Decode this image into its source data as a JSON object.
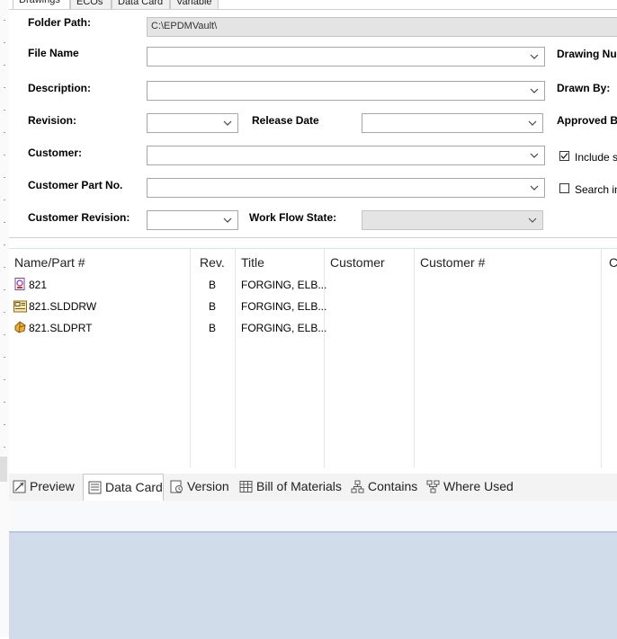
{
  "top_tabs": [
    "Drawings",
    "ECOs",
    "Data Card",
    "Variable"
  ],
  "search": {
    "folder_path_label": "Folder Path:",
    "folder_path_value": "C:\\EPDMVault\\",
    "file_name_label": "File Name",
    "file_name_value": "",
    "description_label": "Description:",
    "description_value": "",
    "revision_label": "Revision:",
    "revision_value": "",
    "release_date_label": "Release Date",
    "release_date_value": "",
    "customer_label": "Customer:",
    "customer_value": "",
    "customer_part_label": "Customer Part No.",
    "customer_part_value": "",
    "customer_revision_label": "Customer Revision:",
    "customer_revision_value": "",
    "workflow_state_label": "Work Flow State:",
    "workflow_state_value": "",
    "drawing_number_label": "Drawing Nu",
    "drawn_by_label": "Drawn By:",
    "approved_by_label": "Approved B",
    "include_label": "Include su",
    "include_checked": true,
    "search_in_label": "Search in",
    "search_in_checked": false
  },
  "results": {
    "columns": [
      "Name/Part #",
      "Rev.",
      "Title",
      "Customer",
      "Customer #",
      "C"
    ],
    "rows": [
      {
        "icon": "part-number-icon",
        "name": "821",
        "rev": "B",
        "title": "FORGING, ELB...",
        "customer": "",
        "customer_no": ""
      },
      {
        "icon": "drawing-file-icon",
        "name": "821.SLDDRW",
        "rev": "B",
        "title": "FORGING, ELB...",
        "customer": "",
        "customer_no": ""
      },
      {
        "icon": "part-file-icon",
        "name": "821.SLDPRT",
        "rev": "B",
        "title": "FORGING, ELB...",
        "customer": "",
        "customer_no": ""
      }
    ]
  },
  "bottom_tabs": [
    {
      "label": "Preview",
      "icon": "preview-icon",
      "active": false
    },
    {
      "label": "Data Card",
      "icon": "data-card-icon",
      "active": true
    },
    {
      "label": "Version",
      "icon": "version-icon",
      "active": false
    },
    {
      "label": "Bill of Materials",
      "icon": "bom-icon",
      "active": false
    },
    {
      "label": "Contains",
      "icon": "contains-icon",
      "active": false
    },
    {
      "label": "Where Used",
      "icon": "where-used-icon",
      "active": false
    }
  ],
  "colors": {
    "accent": "#d0dce9",
    "panel_border": "#b9c8d9",
    "disabled_field": "#e4e4e4"
  }
}
